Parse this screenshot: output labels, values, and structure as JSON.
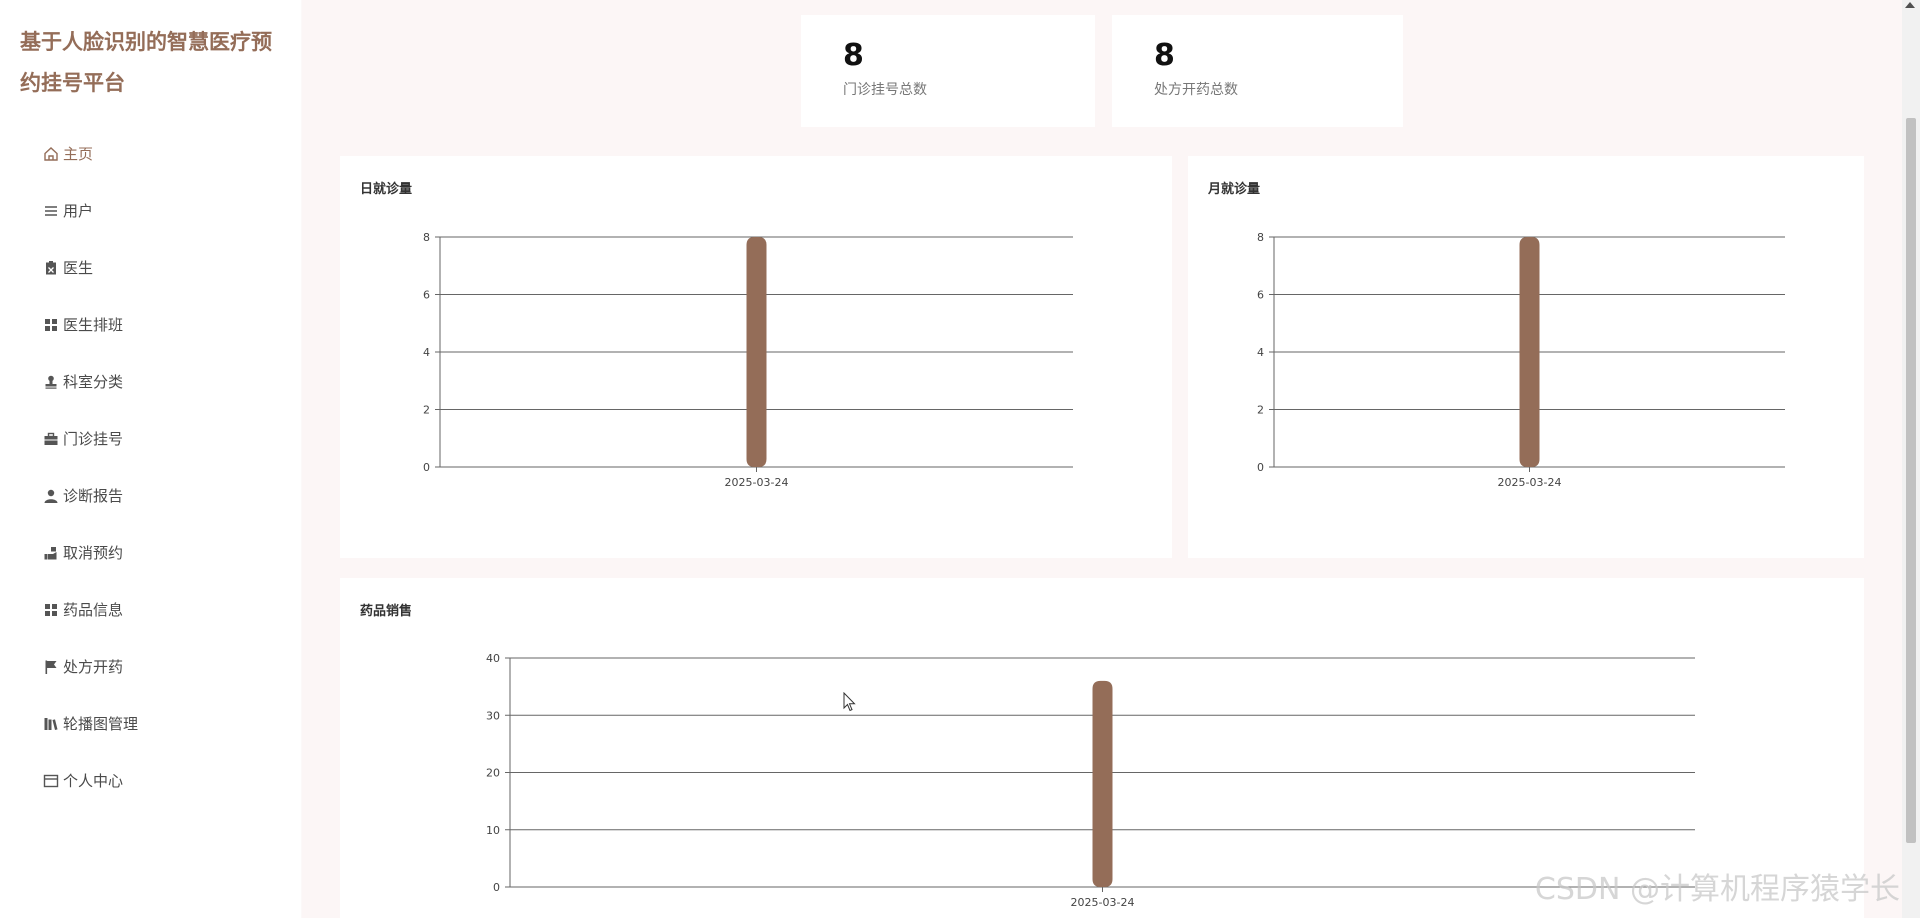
{
  "brand": {
    "title": "基于人脸识别的智慧医疗预约挂号平台"
  },
  "menu": [
    {
      "label": "主页",
      "icon": "home-icon",
      "active": true
    },
    {
      "label": "用户",
      "icon": "list-icon"
    },
    {
      "label": "医生",
      "icon": "clipboard-icon"
    },
    {
      "label": "医生排班",
      "icon": "grid-icon"
    },
    {
      "label": "科室分类",
      "icon": "stamp-icon"
    },
    {
      "label": "门诊挂号",
      "icon": "briefcase-icon"
    },
    {
      "label": "诊断报告",
      "icon": "user-icon"
    },
    {
      "label": "取消预约",
      "icon": "hand-icon"
    },
    {
      "label": "药品信息",
      "icon": "grid-icon"
    },
    {
      "label": "处方开药",
      "icon": "flag-icon"
    },
    {
      "label": "轮播图管理",
      "icon": "library-icon"
    },
    {
      "label": "个人中心",
      "icon": "window-icon"
    }
  ],
  "stats": [
    {
      "value": "8",
      "label": "门诊挂号总数"
    },
    {
      "value": "8",
      "label": "处方开药总数"
    }
  ],
  "chart_data": [
    {
      "type": "bar",
      "title": "日就诊量",
      "categories": [
        "2025-03-24"
      ],
      "values": [
        8
      ],
      "ylim": [
        0,
        8
      ],
      "yticks": [
        0,
        2,
        4,
        6,
        8
      ],
      "grid": true,
      "color": "#946d58"
    },
    {
      "type": "bar",
      "title": "月就诊量",
      "categories": [
        "2025-03-24"
      ],
      "values": [
        8
      ],
      "ylim": [
        0,
        8
      ],
      "yticks": [
        0,
        2,
        4,
        6,
        8
      ],
      "grid": true,
      "color": "#946d58"
    },
    {
      "type": "bar",
      "title": "药品销售",
      "categories": [
        "2025-03-24"
      ],
      "values": [
        36
      ],
      "ylim": [
        0,
        40
      ],
      "yticks": [
        0,
        10,
        20,
        30,
        40
      ],
      "grid": true,
      "color": "#946d58"
    }
  ],
  "watermark": "CSDN @计算机程序猿学长",
  "colors": {
    "accent": "#946d58",
    "text": "#4a4a4a"
  }
}
